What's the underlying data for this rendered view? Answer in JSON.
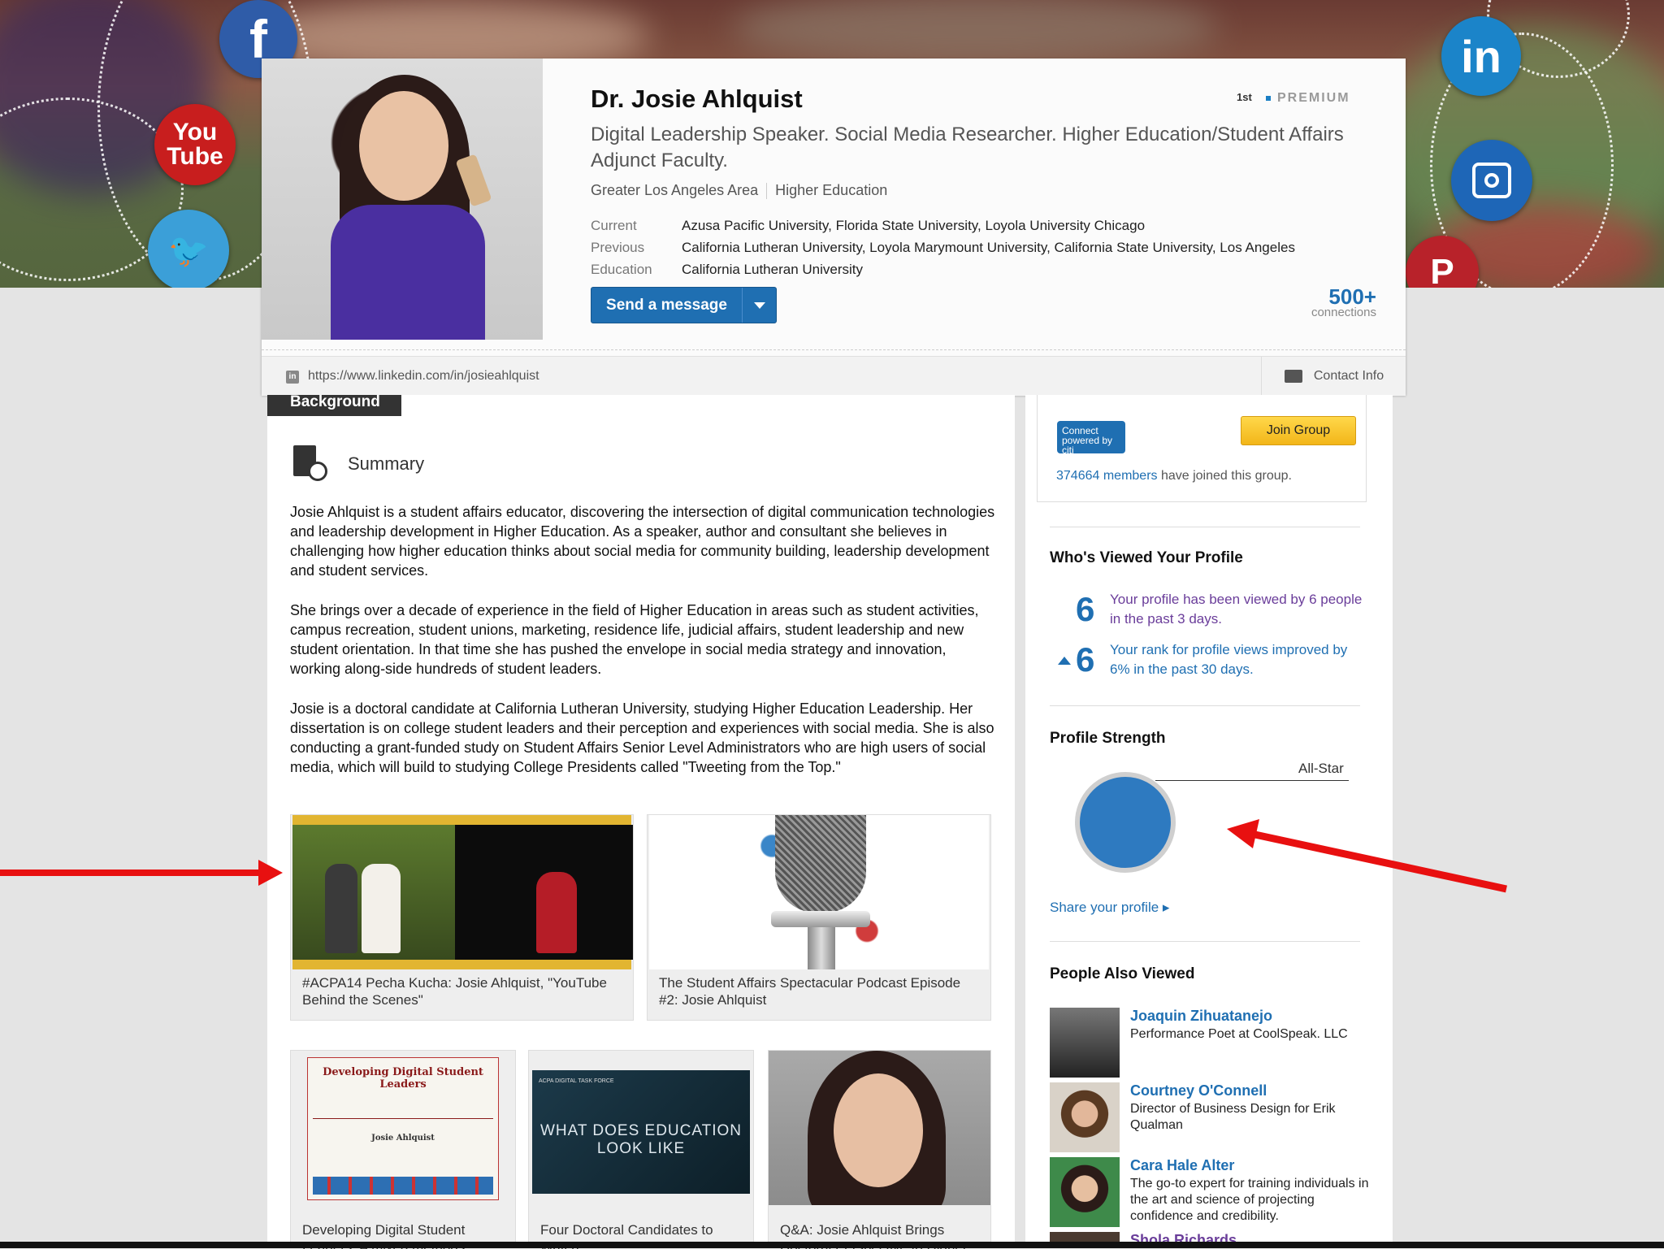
{
  "profile": {
    "name": "Dr. Josie Ahlquist",
    "degree": "1st",
    "premium": "PREMIUM",
    "headline": "Digital Leadership Speaker. Social Media Researcher. Higher Education/Student Affairs Adjunct Faculty.",
    "location": "Greater Los Angeles Area",
    "industry": "Higher Education",
    "current_label": "Current",
    "current": "Azusa Pacific University, Florida State University, Loyola University Chicago",
    "previous_label": "Previous",
    "previous": "California Lutheran University, Loyola Marymount University, California State University, Los Angeles",
    "education_label": "Education",
    "education": "California Lutheran University",
    "send_message": "Send a message",
    "connections_count": "500+",
    "connections_label": "connections",
    "url": "https://www.linkedin.com/in/josieahlquist",
    "contact_info": "Contact Info"
  },
  "banner": {
    "facebook": "f",
    "youtube_1": "You",
    "youtube_2": "Tube",
    "linkedin": "in"
  },
  "main": {
    "section_tab": "Background",
    "summary_title": "Summary",
    "paragraphs": [
      "Josie Ahlquist is a student affairs educator, discovering the intersection of digital communication technologies and leadership development in Higher Education.  As a speaker, author and consultant she believes in challenging how higher education thinks about social media for community building, leadership development and student services.",
      "She brings over a decade of experience in the field of Higher Education in areas such as student activities, campus recreation, student unions, marketing, residence life, judicial affairs, student leadership and new student orientation.  In that time she has pushed the envelope in social media strategy and innovation, working along-side hundreds of student leaders.",
      "Josie is a doctoral candidate at California Lutheran University, studying Higher Education Leadership. Her dissertation is on college student leaders and their perception and experiences with social media.  She is also conducting a grant-funded study on Student Affairs Senior Level Administrators who are high users of social media, which will build to studying College Presidents called \"Tweeting from the Top.\""
    ],
    "media": [
      {
        "caption": "#ACPA14 Pecha Kucha: Josie Ahlquist, \"YouTube Behind the Scenes\""
      },
      {
        "caption": "The Student Affairs Spectacular Podcast Episode #2: Josie Ahlquist"
      },
      {
        "caption": "Developing Digital Student Leaders: A mixed methods",
        "thumb_title": "Developing Digital Student Leaders",
        "thumb_author": "Josie Ahlquist"
      },
      {
        "caption": "Four Doctoral Candidates to Watch",
        "thumb_tag": "ACPA DIGITAL TASK FORCE",
        "thumb_text": "WHAT DOES EDUCATION LOOK LIKE"
      },
      {
        "caption": "Q&A: Josie Ahlquist Brings Doctoral Perspective to Higher"
      }
    ]
  },
  "sidebar": {
    "citi_logo": "Connect powered by citi",
    "join_group": "Join Group",
    "members_count": "374664 members",
    "members_suffix": " have joined this group.",
    "whos_viewed_title": "Who's Viewed Your Profile",
    "views_num": "6",
    "views_text": "Your profile has been viewed by 6 people in the past 3 days.",
    "rank_num": "6",
    "rank_text": "Your rank for profile views improved by 6% in the past 30 days.",
    "strength_title": "Profile Strength",
    "strength_level": "All-Star",
    "share_profile": "Share your profile ▸",
    "people_title": "People Also Viewed",
    "people": [
      {
        "name": "Joaquin Zihuatanejo",
        "title": "Performance Poet at CoolSpeak. LLC"
      },
      {
        "name": "Courtney O'Connell",
        "title": "Director of Business Design for Erik Qualman"
      },
      {
        "name": "Cara Hale Alter",
        "title": "The go-to expert for training individuals in the art and science of projecting confidence and credibility."
      },
      {
        "name": "Shola Richards",
        "title": ""
      }
    ]
  },
  "colors": {
    "linkedin_blue": "#1f6fb2",
    "annotation_red": "#e81010"
  }
}
